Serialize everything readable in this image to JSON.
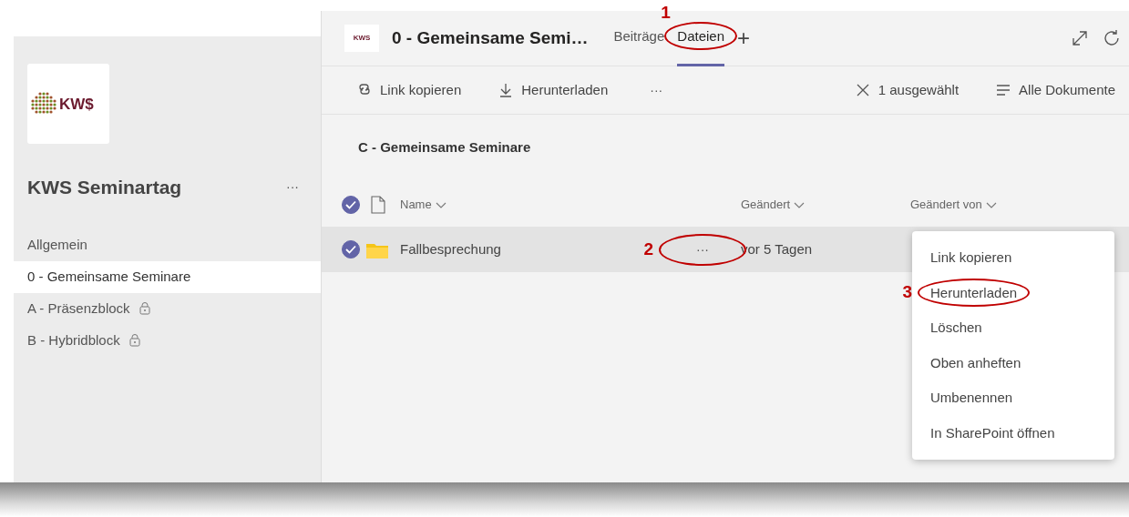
{
  "sidebar": {
    "logo_text": "KW$",
    "team_name": "KWS Seminartag",
    "more": "···",
    "channels": [
      {
        "label": "Allgemein",
        "selected": false,
        "locked": false
      },
      {
        "label": "0 - Gemeinsame Seminare",
        "selected": true,
        "locked": false
      },
      {
        "label": "A - Präsenzblock",
        "selected": false,
        "locked": true
      },
      {
        "label": "B - Hybridblock",
        "selected": false,
        "locked": true
      }
    ]
  },
  "header": {
    "logo_text": "KWS",
    "title": "0 - Gemeinsame Semi…",
    "tabs": [
      {
        "label": "Beiträge",
        "selected": false
      },
      {
        "label": "Dateien",
        "selected": true,
        "annotation": "1"
      }
    ],
    "add": "+"
  },
  "toolbar": {
    "left": [
      {
        "kind": "link",
        "label": "Link kopieren"
      },
      {
        "kind": "download",
        "label": "Herunterladen"
      },
      {
        "kind": "more",
        "label": "···"
      }
    ],
    "right": [
      {
        "kind": "clear",
        "label": "1 ausgewählt"
      },
      {
        "kind": "view",
        "label": "Alle Dokumente"
      }
    ]
  },
  "breadcrumb": "C - Gemeinsame Seminare",
  "table": {
    "all_checked": true,
    "columns": [
      "Name",
      "Geändert",
      "Geändert von"
    ],
    "rows": [
      {
        "name": "Fallbesprechung",
        "selected": true,
        "more": "···",
        "annotation": "2",
        "modified": "vor 5 Tagen"
      }
    ]
  },
  "context_menu": {
    "items": [
      {
        "label": "Link kopieren"
      },
      {
        "label": "Herunterladen",
        "annotation": "3"
      },
      {
        "label": "Löschen"
      },
      {
        "label": "Oben anheften"
      },
      {
        "label": "Umbenennen"
      },
      {
        "label": "In SharePoint öffnen"
      }
    ]
  }
}
